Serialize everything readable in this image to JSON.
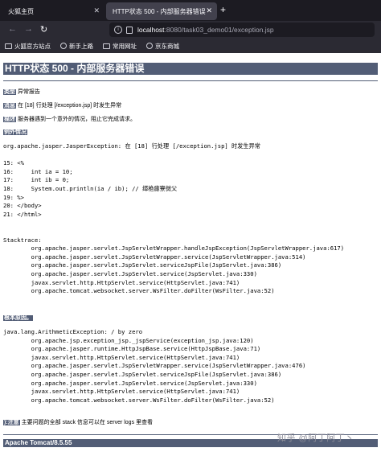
{
  "browser": {
    "tabs": [
      {
        "label": "火狐主页",
        "active": false
      },
      {
        "label": "HTTP状态 500 - 内部服务器错误",
        "active": true
      }
    ],
    "url_host": "localhost",
    "url_path": ":8080/task03_demo01/exception.jsp",
    "bookmarks": [
      "火狐官方站点",
      "新手上路",
      "常用网址",
      "京东商城"
    ]
  },
  "page": {
    "title": "HTTP状态 500 - 内部服务器错误",
    "type_label": "类型",
    "type_value": "异常报告",
    "message_label": "消息",
    "message_value": "在 [18] 行处理 [/exception.jsp] 时发生异常",
    "description_label": "描述",
    "description_value": "服务器遇到一个意外的情况，阻止它完成请求。",
    "exception_label": "例外情况",
    "exception_text": "org.apache.jasper.JasperException: 在 [18] 行处理 [/exception.jsp] 时发生异常\n\n15: <%\n16:     int ia = 10;\n17:     int ib = 0;\n18:     System.out.println(ia / ib); // 缂栬瘧寮傚父\n19: %>\n20: </body>\n21: </html>\n\n\nStacktrace:\n\torg.apache.jasper.servlet.JspServletWrapper.handleJspException(JspServletWrapper.java:617)\n\torg.apache.jasper.servlet.JspServletWrapper.service(JspServletWrapper.java:514)\n\torg.apache.jasper.servlet.JspServlet.serviceJspFile(JspServlet.java:386)\n\torg.apache.jasper.servlet.JspServlet.service(JspServlet.java:330)\n\tjavax.servlet.http.HttpServlet.service(HttpServlet.java:741)\n\torg.apache.tomcat.websocket.server.WsFilter.doFilter(WsFilter.java:52)",
    "root_cause_label": "根本原因。",
    "root_cause_text": "java.lang.ArithmeticException: / by zero\n\torg.apache.jsp.exception_jsp._jspService(exception_jsp.java:120)\n\torg.apache.jasper.runtime.HttpJspBase.service(HttpJspBase.java:71)\n\tjavax.servlet.http.HttpServlet.service(HttpServlet.java:741)\n\torg.apache.jasper.servlet.JspServletWrapper.service(JspServletWrapper.java:476)\n\torg.apache.jasper.servlet.JspServlet.serviceJspFile(JspServlet.java:386)\n\torg.apache.jasper.servlet.JspServlet.service(JspServlet.java:330)\n\tjavax.servlet.http.HttpServlet.service(HttpServlet.java:741)\n\torg.apache.tomcat.websocket.server.WsFilter.doFilter(WsFilter.java:52)",
    "note_label": "):注意",
    "note_value": "主要问题的全部 stack 信息可以在 server logs 里查看",
    "footer": "Apache Tomcat/8.5.55",
    "watermark": "知乎 @阿丁阿丁丶"
  }
}
